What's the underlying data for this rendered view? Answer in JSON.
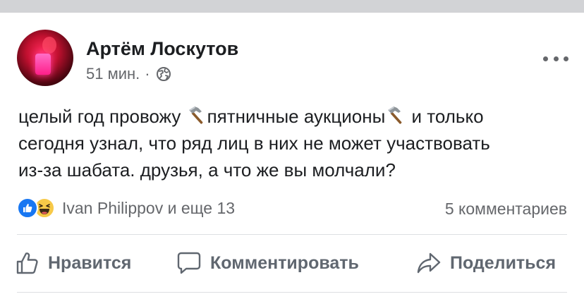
{
  "post": {
    "author": "Артём Лоскутов",
    "time": "51 мин.",
    "separator": "·",
    "privacy_icon": "globe-icon",
    "more_icon": "more-options-icon",
    "text_lines": [
      {
        "before": "целый год провожу ",
        "mid": "пятничные аукционы",
        "after": " и только"
      },
      {
        "text": "сегодня узнал, что ряд лиц в них не может участвовать"
      },
      {
        "text": "из-за шабата. друзья, а что же вы молчали?"
      }
    ],
    "emoji": "hammer-icon"
  },
  "reactions": {
    "icons": [
      "like-reaction-icon",
      "haha-reaction-icon"
    ],
    "summary": "Ivan Philippov и еще 13",
    "comments": "5 комментариев"
  },
  "actions": {
    "like_label": "Нравится",
    "comment_label": "Комментировать",
    "share_label": "Поделиться"
  },
  "colors": {
    "text": "#1c1e21",
    "secondary": "#65676b",
    "action": "#606770",
    "like_blue": "#1877f2",
    "haha_yellow": "#f7c948",
    "top_strip": "#d2d3d6"
  }
}
